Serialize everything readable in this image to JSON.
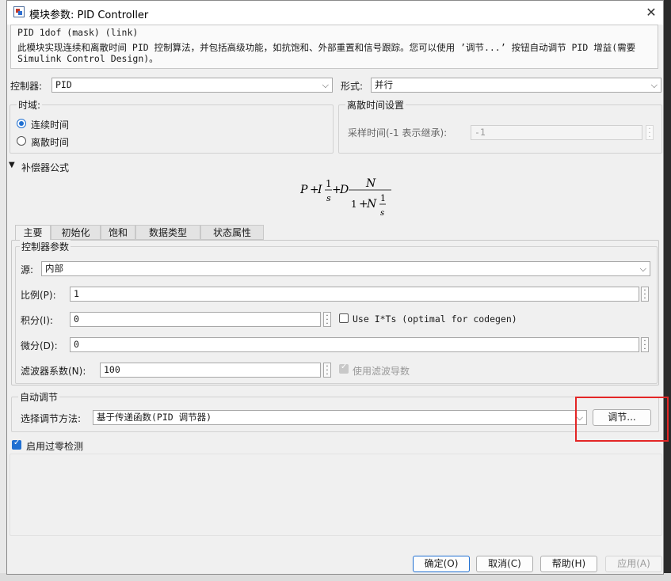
{
  "window": {
    "title": "模块参数: PID Controller"
  },
  "description": {
    "heading": "PID 1dof (mask) (link)",
    "body": "此模块实现连续和离散时间 PID 控制算法，并包括高级功能，如抗饱和、外部重置和信号跟踪。您可以使用 ’调节...’ 按钮自动调节 PID 增益(需要 Simulink Control Design)。"
  },
  "controller": {
    "label": "控制器:",
    "value": "PID"
  },
  "form": {
    "label": "形式:",
    "value": "并行"
  },
  "time_domain": {
    "title": "时域:",
    "options": [
      "连续时间",
      "离散时间"
    ],
    "selected": "连续时间"
  },
  "discrete": {
    "title": "离散时间设置",
    "sample_time_label": "采样时间(-1 表示继承):",
    "sample_time_value": "-1"
  },
  "compensator": {
    "label": "补偿器公式"
  },
  "formula": {
    "P": "P",
    "I": "I",
    "D": "D",
    "N": "N",
    "plus": "+",
    "one": "1",
    "s": "s"
  },
  "tabs": [
    "主要",
    "初始化",
    "饱和",
    "数据类型",
    "状态属性"
  ],
  "active_tab": "主要",
  "controller_params": {
    "title": "控制器参数",
    "source_label": "源:",
    "source_value": "内部",
    "p_label": "比例(P):",
    "p_value": "1",
    "i_label": "积分(I):",
    "i_value": "0",
    "use_its_label": "Use I*Ts (optimal for codegen)",
    "d_label": "微分(D):",
    "d_value": "0",
    "n_label": "滤波器系数(N):",
    "n_value": "100",
    "filter_label": "使用滤波导数"
  },
  "autotune": {
    "title": "自动调节",
    "method_label": "选择调节方法:",
    "method_value": "基于传递函数(PID 调节器)",
    "tune_button": "调节..."
  },
  "zero_cross": {
    "label": "启用过零检测",
    "checked": true
  },
  "buttons": {
    "ok": "确定(O)",
    "cancel": "取消(C)",
    "help": "帮助(H)",
    "apply": "应用(A)"
  },
  "colors": {
    "accent": "#1f6fd1",
    "highlight": "#e32626"
  }
}
